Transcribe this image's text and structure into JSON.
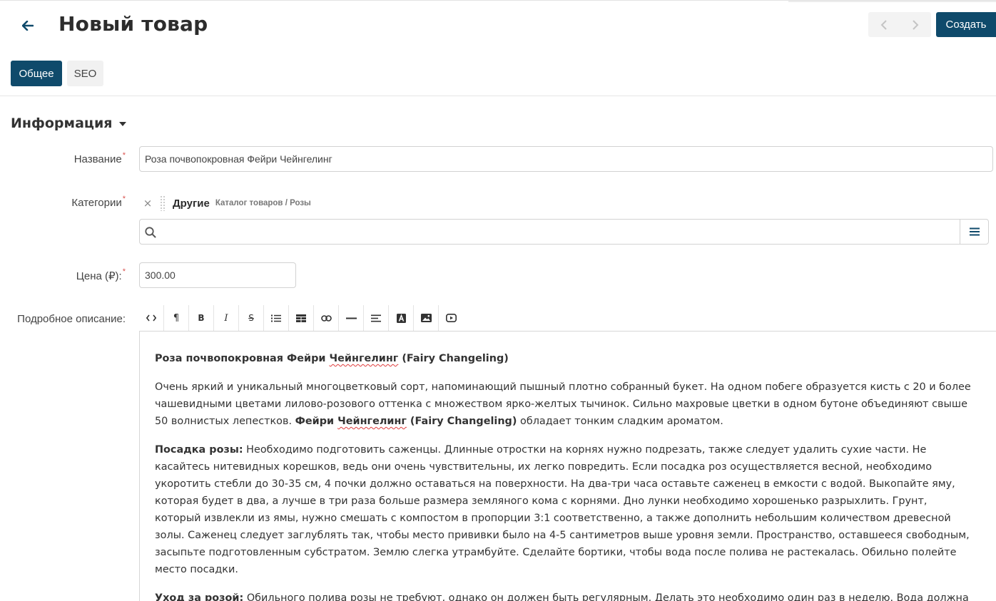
{
  "header": {
    "title": "Новый товар",
    "create_label": "Создать"
  },
  "tabs": [
    {
      "label": "Общее",
      "active": true
    },
    {
      "label": "SEO",
      "active": false
    }
  ],
  "section": {
    "title": "Информация"
  },
  "fields": {
    "name": {
      "label": "Название",
      "required_mark": "*",
      "value": "Роза почвопокровная Фейри Чейнгелинг"
    },
    "categories": {
      "label": "Категории",
      "required_mark": "*",
      "selected": {
        "name": "Другие",
        "path": "Каталог товаров / Розы"
      },
      "search_value": ""
    },
    "price": {
      "label": "Цена (₽):",
      "required_mark": "*",
      "value": "300.00"
    },
    "description": {
      "label": "Подробное описание:"
    }
  },
  "editor": {
    "toolbar": [
      "code-icon",
      "paragraph-icon",
      "bold-icon",
      "italic-icon",
      "strikethrough-icon",
      "unordered-list-icon",
      "table-icon",
      "link-icon",
      "horizontal-rule-icon",
      "align-icon",
      "font-color-icon",
      "image-icon",
      "video-icon"
    ],
    "toolbar_glyphs": {
      "paragraph": "¶",
      "bold": "B",
      "italic": "I",
      "strike": "S"
    },
    "p1_bold_a": "Роза почвопокровная Фейри ",
    "p1_bold_b": "Чейнгелинг",
    "p1_bold_c": " (Fairy Changeling)",
    "p2_a": "Очень яркий и уникальный многоцветковый сорт, напоминающий пышный плотно собранный букет. На одном побеге образуется кисть с 20 и более чашевидными цветами лилово-розового оттенка с множеством ярко-желтых тычинок. Сильно махровые цветки в одном бутоне объединяют свыше 50 волнистых лепестков. ",
    "p2_bold_a": "Фейри ",
    "p2_bold_b": "Чейнгелинг",
    "p2_bold_c": " (Fairy Changeling)",
    "p2_b": " обладает тонким сладким ароматом.",
    "p3_bold": "Посадка розы:",
    "p3": " Необходимо подготовить саженцы. Длинные отростки на корнях нужно подрезать, также следует удалить сухие части. Не касайтесь нитевидных корешков, ведь они очень чувствительны, их легко повредить. Если посадка роз осуществляется весной, необходимо укоротить стебли до 30-35 см, 4 почки должно оставаться на поверхности. На два-три часа оставьте саженец в емкости с водой. Выкопайте яму, которая будет в два, а лучше в три раза больше размера земляного кома с корнями. Дно лунки необходимо хорошенько разрыхлить. Грунт, который извлекли из ямы, нужно смешать с компостом в пропорции 3:1 соответственно, а также дополнить небольшим количеством древесной золы. Саженец следует заглублять так, чтобы место прививки было на 4-5 сантиметров выше уровня земли. Пространство, оставшееся свободным, засыпьте подготовленным субстратом. Землю слегка утрамбуйте. Сделайте бортики, чтобы вода после полива не растекалась. Обильно полейте место посадки.",
    "p4_bold": "Уход за розой:",
    "p4": " Обильного полива розы не требуют, однако он должен быть регулярным. Делать это необходимо один раз в неделю. Вода должна промочить слой земли толщиной в 25 см. В противном случае куст пускает поверхностные корни, которые легко повреждаются во время рыхления"
  },
  "colors": {
    "primary": "#0f4a6b",
    "required": "#d9534f"
  }
}
